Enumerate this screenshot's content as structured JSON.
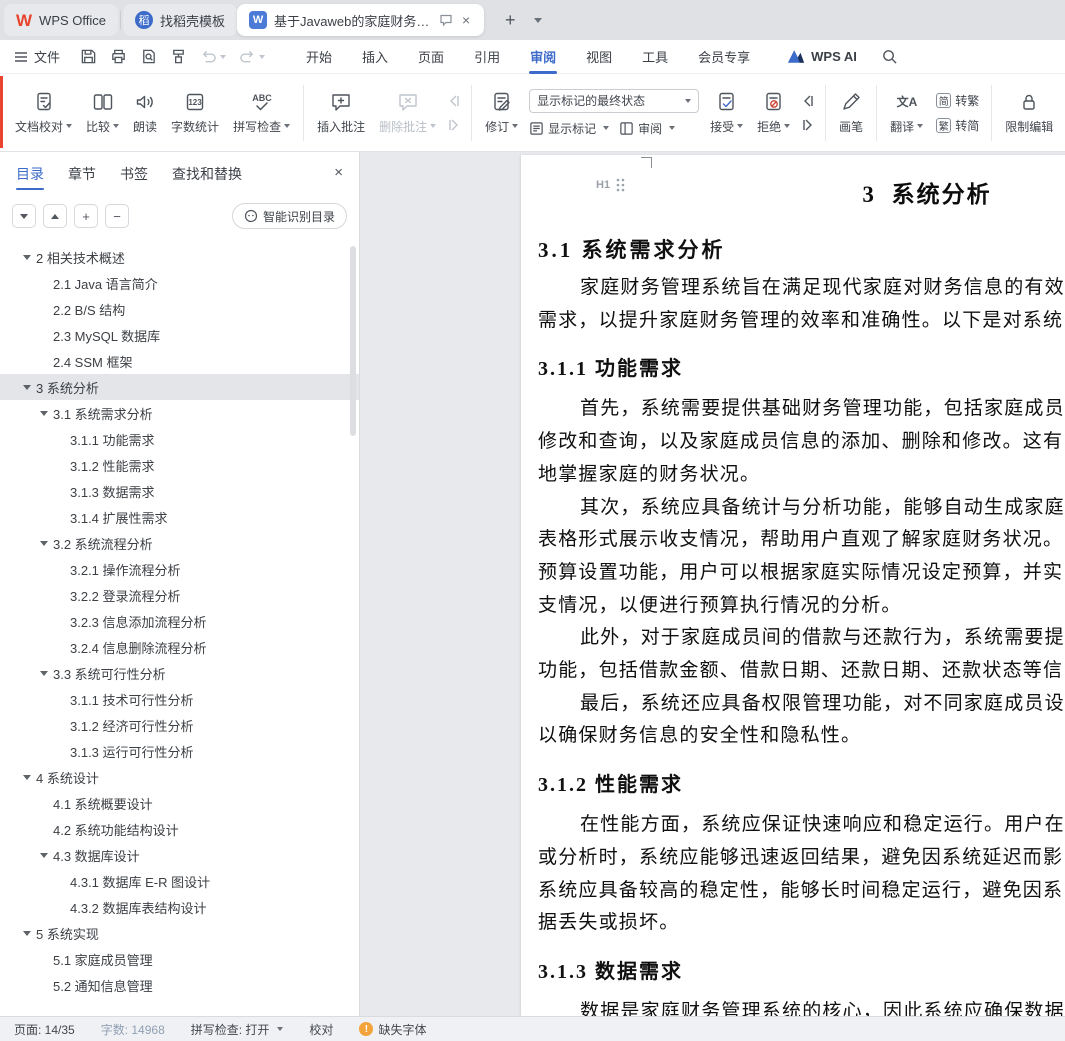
{
  "colors": {
    "accent_blue": "#3c6bc9",
    "brand_red": "#e8442e",
    "warning_orange": "#f2a33c",
    "toc_active_bg": "#e3e5e9"
  },
  "tabbar": {
    "home_tab": {
      "label": "WPS Office",
      "logo_letter": "W"
    },
    "docer_tab": {
      "label": "找稻壳模板",
      "icon_letter": "稻"
    },
    "doc_tab": {
      "label": "基于Javaweb的家庭财务管理",
      "icon_letter": "W"
    },
    "new_tab_glyph": "+",
    "close_glyph": "×"
  },
  "menubar": {
    "file_label": "文件",
    "tabs": [
      "开始",
      "插入",
      "页面",
      "引用",
      "审阅",
      "视图",
      "工具",
      "会员专享"
    ],
    "active_tab": "审阅",
    "ai_label": "WPS AI"
  },
  "ribbon": {
    "doc_proof": "文档校对",
    "compare": "比较",
    "read_aloud": "朗读",
    "word_count": "字数统计",
    "spell_check": "拼写检查",
    "spell_glyph": "ABC",
    "count_glyph": "123",
    "insert_comment": "插入批注",
    "delete_comment": "删除批注",
    "track_changes": "修订",
    "markup_state": "显示标记的最终状态",
    "show_markup": "显示标记",
    "review_pane": "审阅",
    "accept": "接受",
    "reject": "拒绝",
    "pen": "画笔",
    "translate": "翻译",
    "translate_glyph": "文A",
    "to_trad_label": "转繁",
    "to_simp_label": "转简",
    "trad_glyph": "繁",
    "simp_glyph": "简",
    "restrict": "限制编辑"
  },
  "sidebar": {
    "tabs": [
      "目录",
      "章节",
      "书签",
      "查找和替换"
    ],
    "active_tab": "目录",
    "close_glyph": "×",
    "zoom_in_glyph": "+",
    "zoom_out_glyph": "−",
    "smart_toc": "智能识别目录",
    "toc": [
      {
        "level": 1,
        "arrow": true,
        "label": "2 相关技术概述"
      },
      {
        "level": 2,
        "arrow": false,
        "label": "2.1 Java 语言简介"
      },
      {
        "level": 2,
        "arrow": false,
        "label": "2.2 B/S 结构"
      },
      {
        "level": 2,
        "arrow": false,
        "label": "2.3 MySQL 数据库"
      },
      {
        "level": 2,
        "arrow": false,
        "label": "2.4 SSM 框架"
      },
      {
        "level": 1,
        "arrow": true,
        "label": "3 系统分析",
        "active": true
      },
      {
        "level": 2,
        "arrow": true,
        "label": "3.1 系统需求分析"
      },
      {
        "level": 3,
        "arrow": false,
        "label": "3.1.1 功能需求"
      },
      {
        "level": 3,
        "arrow": false,
        "label": "3.1.2 性能需求"
      },
      {
        "level": 3,
        "arrow": false,
        "label": "3.1.3 数据需求"
      },
      {
        "level": 3,
        "arrow": false,
        "label": "3.1.4 扩展性需求"
      },
      {
        "level": 2,
        "arrow": true,
        "label": "3.2 系统流程分析"
      },
      {
        "level": 3,
        "arrow": false,
        "label": "3.2.1 操作流程分析"
      },
      {
        "level": 3,
        "arrow": false,
        "label": "3.2.2 登录流程分析"
      },
      {
        "level": 3,
        "arrow": false,
        "label": "3.2.3 信息添加流程分析"
      },
      {
        "level": 3,
        "arrow": false,
        "label": "3.2.4 信息删除流程分析"
      },
      {
        "level": 2,
        "arrow": true,
        "label": "3.3 系统可行性分析"
      },
      {
        "level": 3,
        "arrow": false,
        "label": "3.1.1 技术可行性分析"
      },
      {
        "level": 3,
        "arrow": false,
        "label": "3.1.2 经济可行性分析"
      },
      {
        "level": 3,
        "arrow": false,
        "label": "3.1.3 运行可行性分析"
      },
      {
        "level": 1,
        "arrow": true,
        "label": "4 系统设计"
      },
      {
        "level": 2,
        "arrow": false,
        "label": "4.1 系统概要设计"
      },
      {
        "level": 2,
        "arrow": false,
        "label": "4.2 系统功能结构设计"
      },
      {
        "level": 2,
        "arrow": true,
        "label": "4.3 数据库设计"
      },
      {
        "level": 3,
        "arrow": false,
        "label": "4.3.1 数据库 E-R 图设计"
      },
      {
        "level": 3,
        "arrow": false,
        "label": "4.3.2 数据库表结构设计"
      },
      {
        "level": 1,
        "arrow": true,
        "label": "5 系统实现"
      },
      {
        "level": 2,
        "arrow": false,
        "label": "5.1 家庭成员管理"
      },
      {
        "level": 2,
        "arrow": false,
        "label": "5.2 通知信息管理"
      }
    ]
  },
  "document": {
    "h1_tag": "H1",
    "chapter_title": "3 系统分析",
    "blocks": [
      {
        "type": "h2",
        "text": "3.1 系统需求分析"
      },
      {
        "type": "p",
        "lines": [
          "家庭财务管理系统旨在满足现代家庭对财务信息的有效",
          "需求，以提升家庭财务管理的效率和准确性。以下是对系统"
        ]
      },
      {
        "type": "h3",
        "text": "3.1.1 功能需求"
      },
      {
        "type": "p",
        "lines": [
          "首先，系统需要提供基础财务管理功能，包括家庭成员的",
          "修改和查询，以及家庭成员信息的添加、删除和修改。这有",
          "地掌握家庭的财务状况。"
        ]
      },
      {
        "type": "p",
        "lines": [
          "其次，系统应具备统计与分析功能，能够自动生成家庭",
          "表格形式展示收支情况，帮助用户直观了解家庭财务状况。",
          "预算设置功能，用户可以根据家庭实际情况设定预算，并实",
          "支情况，以便进行预算执行情况的分析。"
        ]
      },
      {
        "type": "p",
        "lines": [
          "此外，对于家庭成员间的借款与还款行为，系统需要提",
          "功能，包括借款金额、借款日期、还款日期、还款状态等信"
        ]
      },
      {
        "type": "p",
        "lines": [
          "最后，系统还应具备权限管理功能，对不同家庭成员设",
          "以确保财务信息的安全性和隐私性。"
        ]
      },
      {
        "type": "h3",
        "text": "3.1.2 性能需求"
      },
      {
        "type": "p",
        "lines": [
          "在性能方面，系统应保证快速响应和稳定运行。用户在",
          "或分析时，系统应能够迅速返回结果，避免因系统延迟而影",
          "系统应具备较高的稳定性，能够长时间稳定运行，避免因系",
          "据丢失或损坏。"
        ]
      },
      {
        "type": "h3",
        "text": "3.1.3 数据需求"
      },
      {
        "type": "p",
        "lines": [
          "数据是家庭财务管理系统的核心，因此系统应确保数据"
        ]
      }
    ]
  },
  "statusbar": {
    "page": "页面: 14/35",
    "words": "字数: 14968",
    "spellcheck": "拼写检查: 打开",
    "proofread": "校对",
    "missing_font": "缺失字体",
    "warning_glyph": "!"
  }
}
